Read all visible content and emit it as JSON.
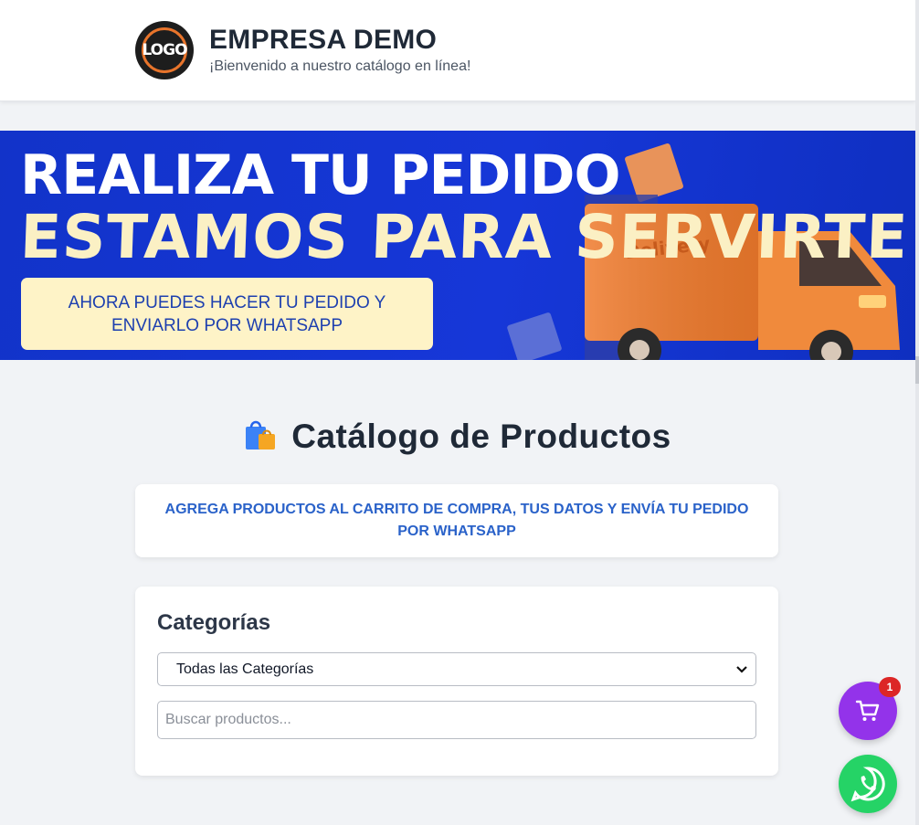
{
  "header": {
    "logo_text": "LOGO",
    "title": "EMPRESA DEMO",
    "subtitle": "¡Bienvenido a nuestro catálogo en línea!"
  },
  "banner": {
    "line1": "REALIZA TU PEDIDO",
    "line2": "ESTAMOS PARA SERVIRTE",
    "box_line1": "AHORA PUEDES HACER TU PEDIDO Y",
    "box_line2": "ENVIARLO POR WHATSAPP",
    "truck_label": "Delivery"
  },
  "catalog": {
    "title": "Catálogo de Productos",
    "icon": "shopping-bags-icon",
    "notice": "AGREGA PRODUCTOS AL CARRITO DE COMPRA, TUS DATOS Y ENVÍA TU PEDIDO POR WHATSAPP"
  },
  "categories": {
    "heading": "Categorías",
    "selected": "Todas las Categorías",
    "search_placeholder": "Buscar productos..."
  },
  "cart": {
    "count": "1",
    "icon": "cart-icon"
  },
  "whatsapp": {
    "icon": "whatsapp-icon"
  },
  "colors": {
    "accent_purple": "#9333ea",
    "whatsapp_green": "#25d366",
    "banner_blue": "#1637d8",
    "notice_blue": "#2a62c9",
    "badge_red": "#dc2626"
  }
}
